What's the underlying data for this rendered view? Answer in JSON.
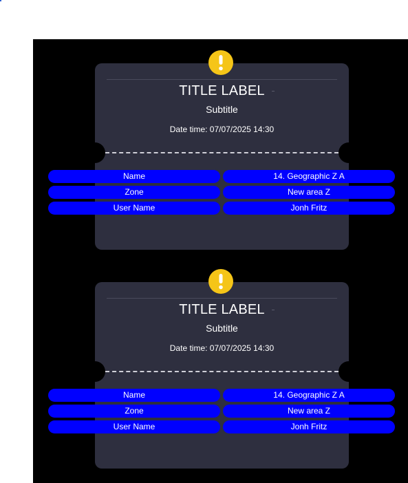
{
  "colors": {
    "page_background": "#ffffff",
    "stage_background": "#000000",
    "card_background": "#2e2f3f",
    "alert_badge": "#f5c518",
    "pill_background": "#0000ff",
    "text": "#ffffff"
  },
  "cards": [
    {
      "alert_icon": "exclamation-icon",
      "title": "TITLE LABEL",
      "subtitle": "Subtitle",
      "datetime": "Date time: 07/07/2025 14:30",
      "fields": [
        {
          "key": "Name",
          "value": "14. Geographic Z A"
        },
        {
          "key": "Zone",
          "value": "New area Z"
        },
        {
          "key": "User Name",
          "value": "Jonh Fritz"
        }
      ]
    },
    {
      "alert_icon": "exclamation-icon",
      "title": "TITLE LABEL",
      "subtitle": "Subtitle",
      "datetime": "Date time: 07/07/2025 14:30",
      "fields": [
        {
          "key": "Name",
          "value": "14. Geographic Z A"
        },
        {
          "key": "Zone",
          "value": "New area Z"
        },
        {
          "key": "User Name",
          "value": "Jonh Fritz"
        }
      ]
    }
  ]
}
